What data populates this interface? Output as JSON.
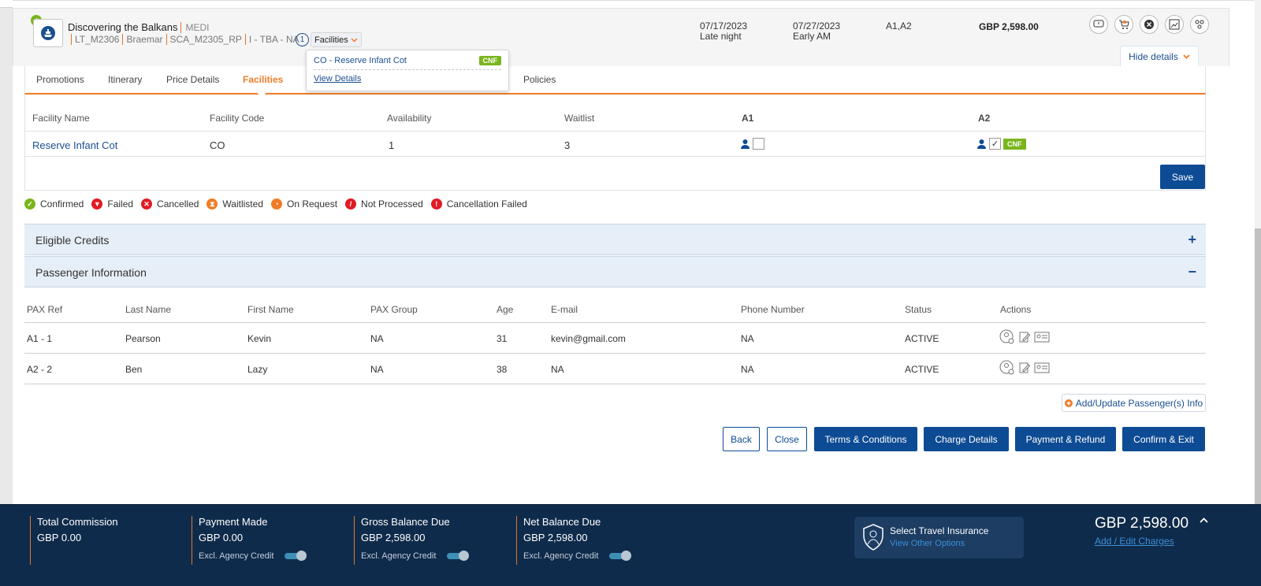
{
  "header": {
    "title": "Discovering the Balkans",
    "brand": "MEDI",
    "codes": [
      "LT_M2306",
      "Braemar",
      "SCA_M2305_RP",
      "I - TBA - NA"
    ],
    "facility_count": "1",
    "facilities_label": "Facilities",
    "start_date": "07/17/2023",
    "start_time": "Late night",
    "end_date": "07/27/2023",
    "end_time": "Early AM",
    "pax": "A1,A2",
    "price": "GBP 2,598.00",
    "hide_details": "Hide details"
  },
  "popover": {
    "item": "CO - Reserve Infant Cot",
    "status": "CNF",
    "view_details": "View Details"
  },
  "tabs": [
    {
      "label": "Promotions"
    },
    {
      "label": "Itinerary"
    },
    {
      "label": "Price Details"
    },
    {
      "label": "Facilities"
    },
    {
      "label": "Policies"
    }
  ],
  "facilities_table": {
    "headers": [
      "Facility Name",
      "Facility Code",
      "Availability",
      "Waitlist",
      "A1",
      "A2"
    ],
    "row": {
      "name": "Reserve Infant Cot",
      "code": "CO",
      "availability": "1",
      "waitlist": "3",
      "a2_status": "CNF",
      "a2_checked": "✓"
    },
    "save": "Save"
  },
  "legend": [
    {
      "label": "Confirmed",
      "color": "#7ab51d"
    },
    {
      "label": "Failed",
      "color": "#e01b24"
    },
    {
      "label": "Cancelled",
      "color": "#e01b24"
    },
    {
      "label": "Waitlisted",
      "color": "#f07c27"
    },
    {
      "label": "On Request",
      "color": "#f07c27"
    },
    {
      "label": "Not Processed",
      "color": "#e01b24"
    },
    {
      "label": "Cancellation Failed",
      "color": "#e01b24"
    }
  ],
  "accordions": {
    "credits": {
      "label": "Eligible Credits",
      "sign": "+"
    },
    "passengers": {
      "label": "Passenger Information",
      "sign": "−"
    }
  },
  "passenger_table": {
    "headers": [
      "PAX Ref",
      "Last Name",
      "First Name",
      "PAX Group",
      "Age",
      "E-mail",
      "Phone Number",
      "Status",
      "Actions"
    ],
    "rows": [
      {
        "ref": "A1 - 1",
        "last": "Pearson",
        "first": "Kevin",
        "group": "NA",
        "age": "31",
        "email": "kevin@gmail.com",
        "phone": "NA",
        "status": "ACTIVE"
      },
      {
        "ref": "A2 - 2",
        "last": "Ben",
        "first": "Lazy",
        "group": "NA",
        "age": "38",
        "email": "NA",
        "phone": "NA",
        "status": "ACTIVE"
      }
    ],
    "add_update": "Add/Update Passenger(s) Info"
  },
  "buttons": {
    "back": "Back",
    "close": "Close",
    "terms": "Terms & Conditions",
    "charge": "Charge Details",
    "payment": "Payment & Refund",
    "confirm": "Confirm & Exit"
  },
  "footer": {
    "commission_label": "Total Commission",
    "commission_value": "GBP 0.00",
    "payment_label": "Payment Made",
    "payment_value": "GBP 0.00",
    "gross_label": "Gross Balance Due",
    "gross_value": "GBP 2,598.00",
    "net_label": "Net Balance Due",
    "net_value": "GBP 2,598.00",
    "excl_label": "Excl. Agency Credit",
    "insurance_title": "Select Travel Insurance",
    "insurance_sub": "View Other Options",
    "total": "GBP 2,598.00",
    "add_edit": "Add / Edit Charges"
  },
  "colors": {
    "accent": "#f07c27",
    "primary": "#0d4b94",
    "footer_bg": "#0f2b4b",
    "confirmed": "#7ab51d"
  }
}
